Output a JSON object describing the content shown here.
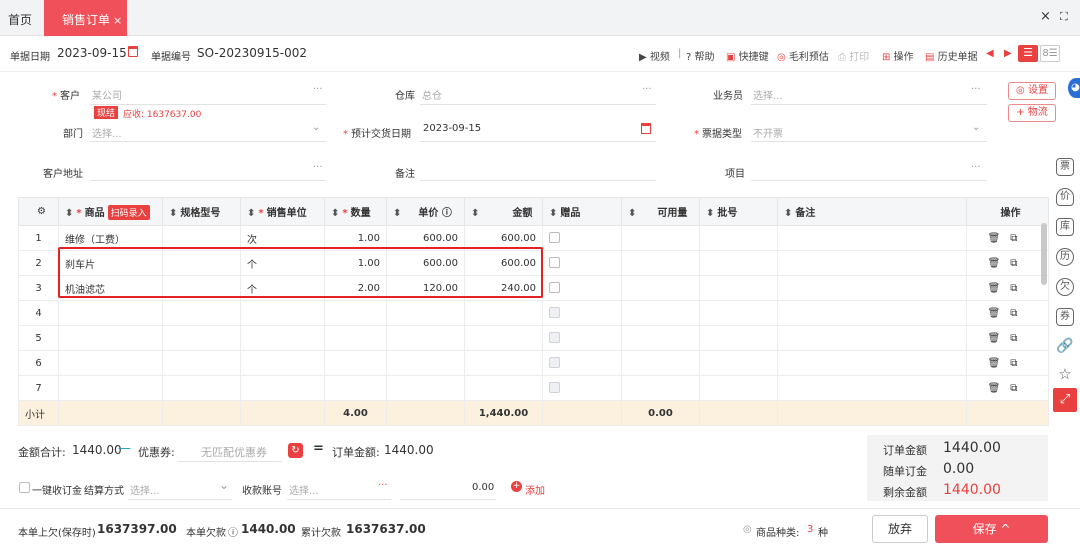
{
  "tabs": {
    "home": "首页",
    "active": "销售订单",
    "close": "×"
  },
  "window": {
    "close": "×",
    "expand": "⛶"
  },
  "header": {
    "date_label": "单据日期",
    "date_value": "2023-09-15",
    "number_label": "单据编号",
    "number_value": "SO-20230915-002"
  },
  "toolbar": {
    "video": "视频",
    "sep": "|",
    "help": "帮助",
    "shortcuts": "快捷键",
    "gross_profit": "毛利预估",
    "print": "打印",
    "actions": "操作",
    "history": "历史单据"
  },
  "form": {
    "customer_label": "客户",
    "customer_value": "某公司",
    "cash_badge": "现结",
    "receivable": "应收: 1637637.00",
    "warehouse_label": "仓库",
    "warehouse_value": "总仓",
    "salesperson_label": "业务员",
    "salesperson_placeholder": "选择...",
    "department_label": "部门",
    "department_placeholder": "选择...",
    "delivery_label": "预计交货日期",
    "delivery_value": "2023-09-15",
    "invoice_label": "票据类型",
    "invoice_value": "不开票",
    "address_label": "客户地址",
    "remark_label": "备注",
    "project_label": "项目",
    "settings_btn": "设置",
    "logistics_btn": "物流"
  },
  "grid": {
    "headers": {
      "product": "商品",
      "scan_entry": "扫码录入",
      "spec": "规格型号",
      "unit": "销售单位",
      "qty": "数量",
      "price": "单价",
      "amount": "金额",
      "gift": "赠品",
      "available": "可用量",
      "batch": "批号",
      "note": "备注",
      "ops": "操作"
    },
    "rows": [
      {
        "no": "1",
        "product": "维修（工费）",
        "unit": "次",
        "qty": "1.00",
        "price": "600.00",
        "amount": "600.00"
      },
      {
        "no": "2",
        "product": "刹车片",
        "unit": "个",
        "qty": "1.00",
        "price": "600.00",
        "amount": "600.00"
      },
      {
        "no": "3",
        "product": "机油滤芯",
        "unit": "个",
        "qty": "2.00",
        "price": "120.00",
        "amount": "240.00"
      },
      {
        "no": "4"
      },
      {
        "no": "5"
      },
      {
        "no": "6"
      },
      {
        "no": "7"
      }
    ],
    "subtotal": {
      "label": "小计",
      "qty": "4.00",
      "amount": "1,440.00",
      "available": "0.00"
    }
  },
  "totals": {
    "total_label": "金额合计:",
    "total_value": "1440.00",
    "coupon_label": "优惠券:",
    "coupon_placeholder": "无匹配优惠券",
    "order_amount_label": "订单金额:",
    "order_amount_value": "1440.00",
    "one_key_label": "一键收订金",
    "settle_label": "结算方式",
    "settle_placeholder": "选择...",
    "account_label": "收款账号",
    "account_placeholder": "选择...",
    "payment_value": "0.00",
    "add_label": "添加"
  },
  "summary": {
    "order_amount_label": "订单金额",
    "order_amount_value": "1440.00",
    "deposit_label": "随单订金",
    "deposit_value": "0.00",
    "remaining_label": "剩余金额",
    "remaining_value": "1440.00"
  },
  "footer": {
    "prev_debt_label": "本单上欠(保存时)",
    "prev_debt_value": "1637397.00",
    "this_debt_label": "本单欠款",
    "this_debt_value": "1440.00",
    "cum_debt_label": "累计欠款",
    "cum_debt_value": "1637637.00",
    "product_types_label": "商品种类:",
    "product_types_value": "3",
    "product_types_unit": "种",
    "discard_btn": "放弃",
    "save_btn": "保存 ^"
  },
  "colors": {
    "accent": "#f0505a",
    "highlight": "#e42222",
    "subtotal_bg": "#fcf1df"
  }
}
